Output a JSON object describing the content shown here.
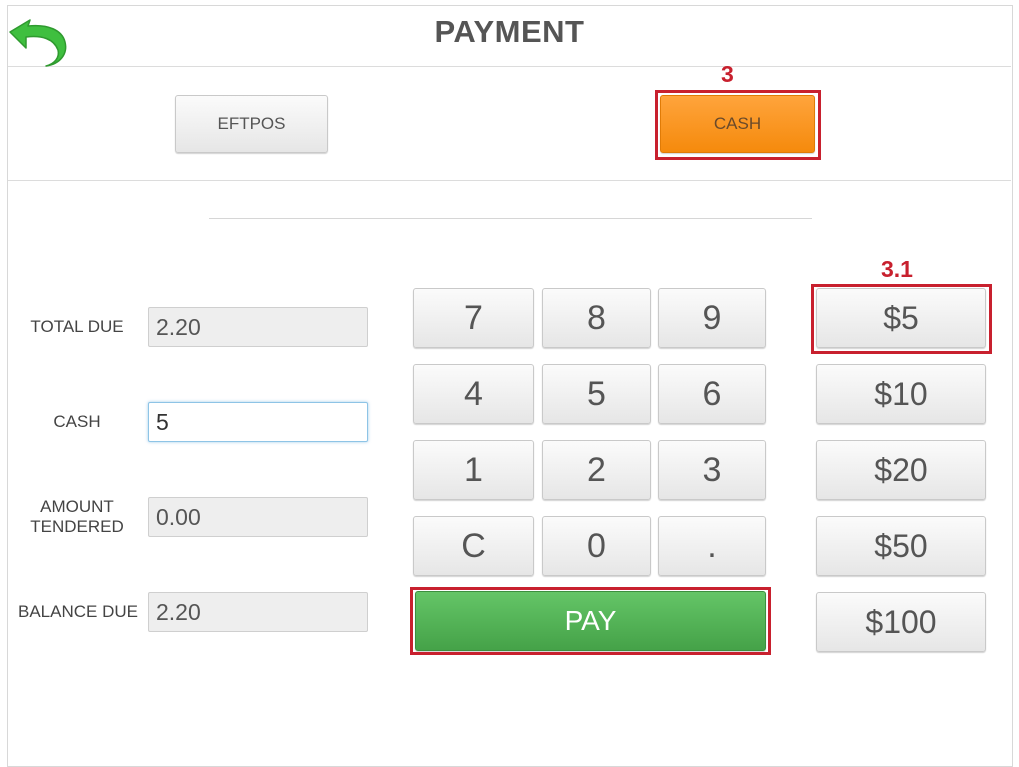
{
  "header": {
    "title": "PAYMENT",
    "back_icon": "back-arrow-icon"
  },
  "payment_methods": {
    "eftpos_label": "EFTPOS",
    "cash_label": "CASH"
  },
  "annotations": {
    "cash_step": "3",
    "quick_amount_step": "3.1"
  },
  "fields": {
    "total_due": {
      "label": "TOTAL DUE",
      "value": "2.20"
    },
    "cash": {
      "label": "CASH",
      "value": "5"
    },
    "amount_tendered": {
      "label": "AMOUNT TENDERED",
      "value": "0.00"
    },
    "balance_due": {
      "label": "BALANCE DUE",
      "value": "2.20"
    }
  },
  "keypad": {
    "keys": [
      "7",
      "8",
      "9",
      "4",
      "5",
      "6",
      "1",
      "2",
      "3",
      "C",
      "0",
      "."
    ],
    "pay_label": "PAY"
  },
  "quick_amounts": [
    "$5",
    "$10",
    "$20",
    "$50",
    "$100"
  ],
  "colors": {
    "accent_orange": "#f7931e",
    "pay_green": "#4caf50",
    "annotation_red": "#c8202e",
    "back_arrow_green": "#3fbf3f"
  }
}
